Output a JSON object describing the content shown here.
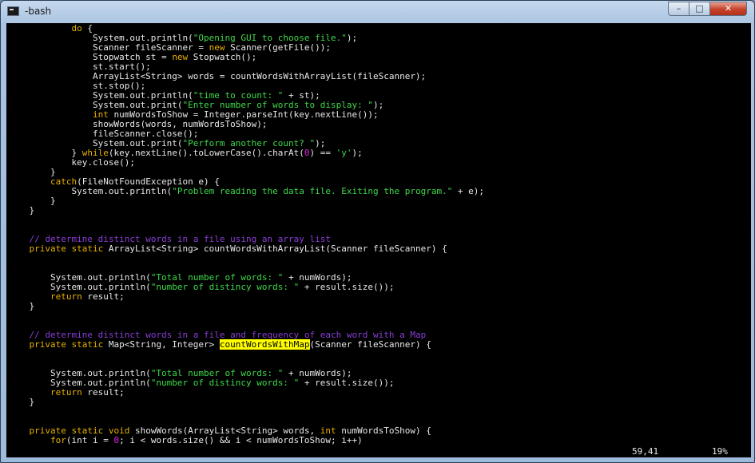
{
  "window": {
    "title": "-bash",
    "controls": {
      "minimize": "–",
      "maximize": "□",
      "close": "✕"
    }
  },
  "colors": {
    "keyword": "#e6b000",
    "string": "#3fd94a",
    "comment": "#8a3dd6",
    "number": "#e020e0",
    "search_highlight": "#ffff00"
  },
  "editor": {
    "lines": [
      [
        [
          "            ",
          ""
        ],
        [
          "do",
          "kw"
        ],
        [
          " {",
          ""
        ]
      ],
      [
        [
          "                System.out.println(",
          ""
        ],
        [
          "\"Opening GUI to choose file.\"",
          "str"
        ],
        [
          ");",
          ""
        ]
      ],
      [
        [
          "                Scanner fileScanner = ",
          ""
        ],
        [
          "new",
          "kw"
        ],
        [
          " Scanner(getFile());",
          ""
        ]
      ],
      [
        [
          "                Stopwatch st = ",
          ""
        ],
        [
          "new",
          "kw"
        ],
        [
          " Stopwatch();",
          ""
        ]
      ],
      [
        [
          "                st.start();",
          ""
        ]
      ],
      [
        [
          "                ArrayList<String> words = countWordsWithArrayList(fileScanner);",
          ""
        ]
      ],
      [
        [
          "                st.stop();",
          ""
        ]
      ],
      [
        [
          "                System.out.println(",
          ""
        ],
        [
          "\"time to count: \"",
          "str"
        ],
        [
          " + st);",
          ""
        ]
      ],
      [
        [
          "                System.out.print(",
          ""
        ],
        [
          "\"Enter number of words to display: \"",
          "str"
        ],
        [
          ");",
          ""
        ]
      ],
      [
        [
          "                ",
          ""
        ],
        [
          "int",
          "kw"
        ],
        [
          " numWordsToShow = Integer.parseInt(key.nextLine());",
          ""
        ]
      ],
      [
        [
          "                showWords(words, numWordsToShow);",
          ""
        ]
      ],
      [
        [
          "                fileScanner.close();",
          ""
        ]
      ],
      [
        [
          "                System.out.print(",
          ""
        ],
        [
          "\"Perform another count? \"",
          "str"
        ],
        [
          ");",
          ""
        ]
      ],
      [
        [
          "            } ",
          ""
        ],
        [
          "while",
          "kw"
        ],
        [
          "(key.nextLine().toLowerCase().charAt(",
          ""
        ],
        [
          "0",
          "num"
        ],
        [
          ") == ",
          ""
        ],
        [
          "'y'",
          "str"
        ],
        [
          ");",
          ""
        ]
      ],
      [
        [
          "            key.close();",
          ""
        ]
      ],
      [
        [
          "        }",
          ""
        ]
      ],
      [
        [
          "        ",
          ""
        ],
        [
          "catch",
          "kw"
        ],
        [
          "(FileNotFoundException e) {",
          ""
        ]
      ],
      [
        [
          "            System.out.println(",
          ""
        ],
        [
          "\"Problem reading the data file. Exiting the program.\"",
          "str"
        ],
        [
          " + e);",
          ""
        ]
      ],
      [
        [
          "        }",
          ""
        ]
      ],
      [
        [
          "    }",
          ""
        ]
      ],
      [],
      [],
      [
        [
          "    ",
          ""
        ],
        [
          "// determine distinct words in a file using an array list",
          "cmt"
        ]
      ],
      [
        [
          "    ",
          ""
        ],
        [
          "private static",
          "kw"
        ],
        [
          " ArrayList<String> countWordsWithArrayList(Scanner fileScanner) {",
          ""
        ]
      ],
      [],
      [],
      [
        [
          "        System.out.println(",
          ""
        ],
        [
          "\"Total number of words: \"",
          "str"
        ],
        [
          " + numWords);",
          ""
        ]
      ],
      [
        [
          "        System.out.println(",
          ""
        ],
        [
          "\"number of distincy words: \"",
          "str"
        ],
        [
          " + result.size());",
          ""
        ]
      ],
      [
        [
          "        ",
          ""
        ],
        [
          "return",
          "kw"
        ],
        [
          " result;",
          ""
        ]
      ],
      [
        [
          "    }",
          ""
        ]
      ],
      [],
      [],
      [
        [
          "    ",
          ""
        ],
        [
          "// determine distinct words in a file and frequency of each word with a Map",
          "cmt"
        ]
      ],
      [
        [
          "    ",
          ""
        ],
        [
          "private static",
          "kw"
        ],
        [
          " Map<String, Integer> ",
          ""
        ],
        [
          "countWordsWithMap",
          "hl"
        ],
        [
          "(Scanner fileScanner) {",
          ""
        ]
      ],
      [],
      [],
      [
        [
          "        System.out.println(",
          ""
        ],
        [
          "\"Total number of words: \"",
          "str"
        ],
        [
          " + numWords);",
          ""
        ]
      ],
      [
        [
          "        System.out.println(",
          ""
        ],
        [
          "\"number of distincy words: \"",
          "str"
        ],
        [
          " + result.size());",
          ""
        ]
      ],
      [
        [
          "        ",
          ""
        ],
        [
          "return",
          "kw"
        ],
        [
          " result;",
          ""
        ]
      ],
      [
        [
          "    }",
          ""
        ]
      ],
      [],
      [],
      [
        [
          "    ",
          ""
        ],
        [
          "private static void",
          "kw"
        ],
        [
          " showWords(ArrayList<String> words, ",
          ""
        ],
        [
          "int",
          "kw"
        ],
        [
          " numWordsToShow) {",
          ""
        ]
      ],
      [
        [
          "        ",
          ""
        ],
        [
          "for",
          "kw"
        ],
        [
          "(int i = ",
          ""
        ],
        [
          "0",
          "num"
        ],
        [
          "; i < words.size() && i < numWordsToShow; i++)",
          ""
        ]
      ]
    ],
    "status": {
      "cursor_position": "59,41",
      "scroll_percent": "19%"
    }
  }
}
